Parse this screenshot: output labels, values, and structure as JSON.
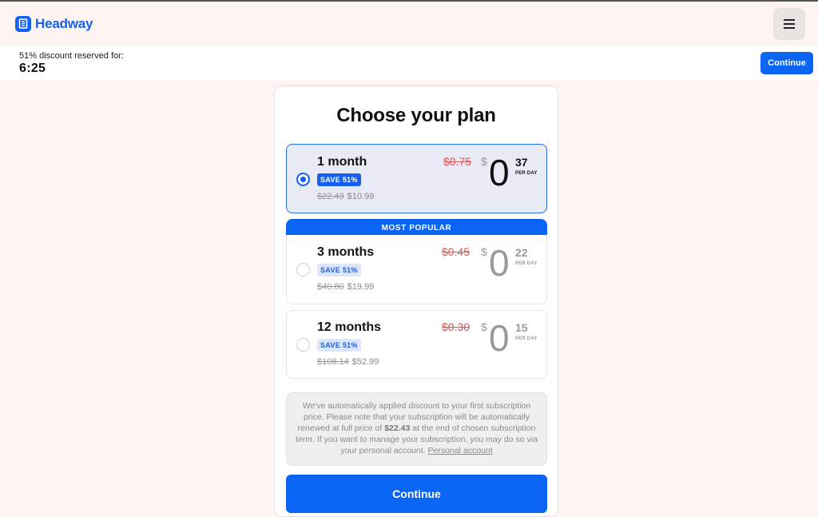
{
  "brand": {
    "name": "Headway"
  },
  "timer": {
    "label": "51% discount reserved for:",
    "value": "6:25",
    "button": "Continue"
  },
  "page": {
    "title": "Choose your plan"
  },
  "plans": [
    {
      "name": "1 month",
      "badge": "SAVE 51%",
      "old_total": "$22.43",
      "new_total": "$10.99",
      "old_per_day": "$0.75",
      "currency": "$",
      "whole": "0",
      "cents": "37",
      "per_day_label": "PER DAY",
      "selected": true
    },
    {
      "name": "3 months",
      "badge": "SAVE 51%",
      "old_total": "$40.80",
      "new_total": "$19.99",
      "old_per_day": "$0.45",
      "currency": "$",
      "whole": "0",
      "cents": "22",
      "per_day_label": "PER DAY",
      "selected": false
    },
    {
      "name": "12 months",
      "badge": "SAVE 51%",
      "old_total": "$108.14",
      "new_total": "$52.99",
      "old_per_day": "$0.30",
      "currency": "$",
      "whole": "0",
      "cents": "15",
      "per_day_label": "PER DAY",
      "selected": false
    }
  ],
  "popular_label": "MOST POPULAR",
  "notice": {
    "text_before": "We've automatically applied discount to your first subscription price. Please note that your subscription will be automatically renewed at full price of ",
    "price": "$22.43",
    "text_after": " at the end of chosen subscription term. If you want to manage your subscription, you may do so via your personal account. ",
    "link": "Personal account"
  },
  "cta": {
    "label": "Continue"
  },
  "colors": {
    "accent": "#0a65f5",
    "background": "#fef5f2",
    "strike": "#dd5555"
  },
  "icons": {
    "logo": "book-icon",
    "menu": "hamburger-icon"
  }
}
